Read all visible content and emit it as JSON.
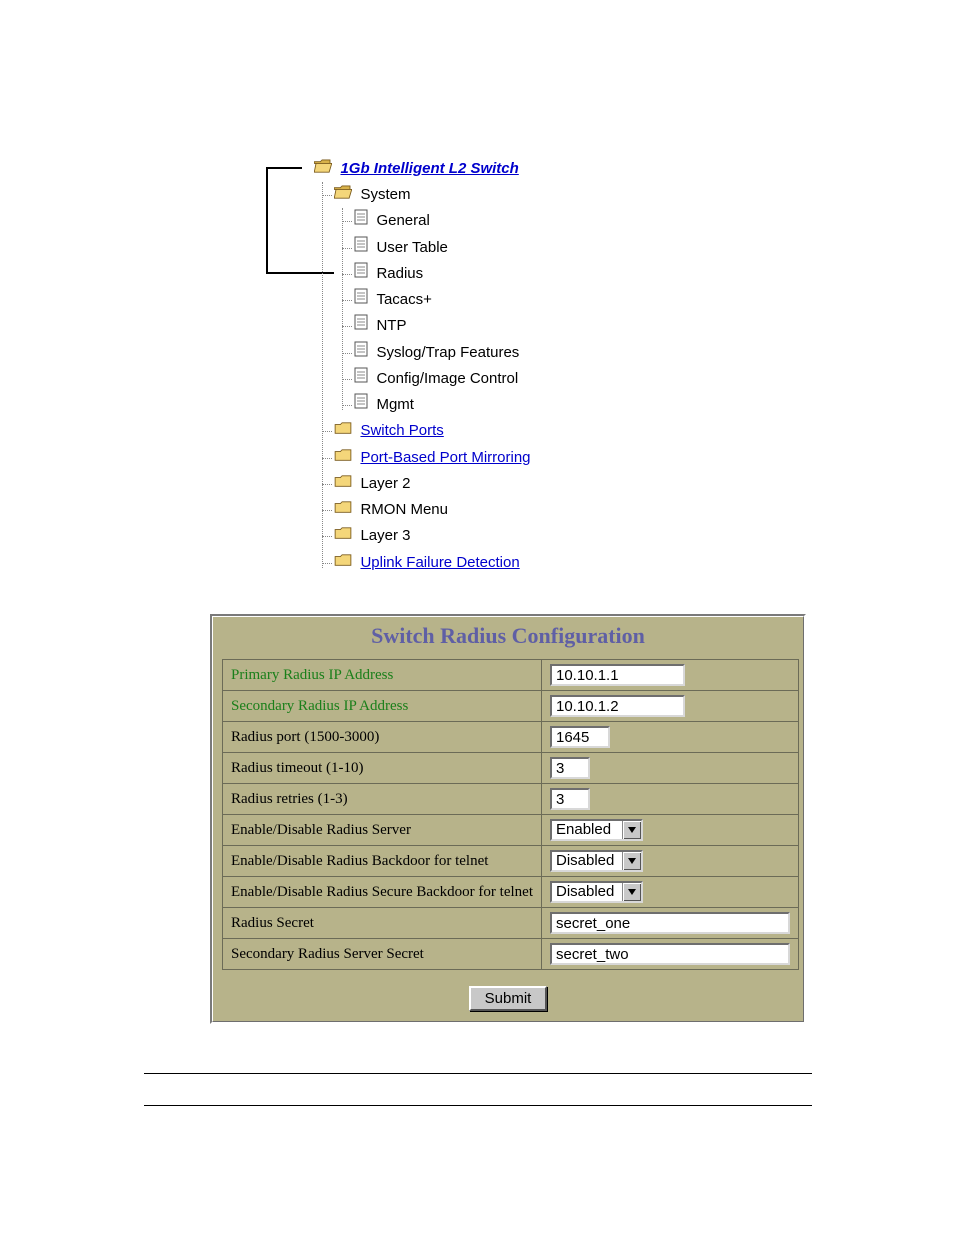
{
  "tree": {
    "root_label": "1Gb Intelligent L2 Switch",
    "system_label": "System",
    "system_items": {
      "general": "General",
      "user_table": "User Table",
      "radius": "Radius",
      "tacacs": "Tacacs+",
      "ntp": "NTP",
      "syslog": "Syslog/Trap Features",
      "config_image": "Config/Image Control",
      "mgmt": "Mgmt"
    },
    "folders": {
      "switch_ports": "Switch Ports",
      "port_mirroring": "Port-Based Port Mirroring",
      "layer2": "Layer 2",
      "rmon": "RMON Menu",
      "layer3": "Layer 3",
      "uplink": "Uplink Failure Detection"
    }
  },
  "form": {
    "title": "Switch Radius Configuration",
    "rows": {
      "primary_ip": {
        "label": "Primary Radius IP Address",
        "value": "10.10.1.1"
      },
      "secondary_ip": {
        "label": "Secondary Radius IP Address",
        "value": "10.10.1.2"
      },
      "port": {
        "label": "Radius port (1500-3000)",
        "value": "1645"
      },
      "timeout": {
        "label": "Radius timeout (1-10)",
        "value": "3"
      },
      "retries": {
        "label": "Radius retries (1-3)",
        "value": "3"
      },
      "enable_server": {
        "label": "Enable/Disable Radius Server",
        "value": "Enabled"
      },
      "enable_backdoor": {
        "label": "Enable/Disable Radius Backdoor for telnet",
        "value": "Disabled"
      },
      "enable_secure_backdoor": {
        "label": "Enable/Disable Radius Secure Backdoor for telnet",
        "value": "Disabled"
      },
      "secret": {
        "label": "Radius Secret",
        "value": "secret_one"
      },
      "secondary_secret": {
        "label": "Secondary Radius Server Secret",
        "value": "secret_two"
      }
    },
    "submit_label": "Submit"
  }
}
